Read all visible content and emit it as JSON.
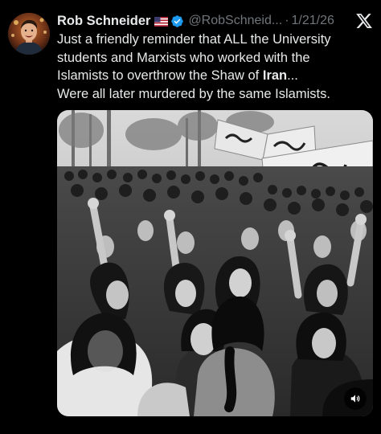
{
  "author": {
    "display_name": "Rob Schneider",
    "handle": "@RobSchneid...",
    "flag_icon": "us-flag-icon",
    "verified_icon": "verified-badge-icon",
    "verified_color": "#1d9bf0"
  },
  "meta": {
    "separator": "·",
    "date": "1/21/26",
    "platform_icon": "x-logo-icon"
  },
  "tweet": {
    "line1": "Just a friendly reminder that ALL the University",
    "line2": "students and Marxists who worked with the",
    "line3_pre": "Islamists to overthrow the Shaw of ",
    "line3_bold": "Iran",
    "line3_post": "...",
    "line4": "Were all later murdered by the same Islamists."
  },
  "media": {
    "kind": "black-and-white protest photograph",
    "volume_icon": "volume-icon"
  },
  "colors": {
    "background": "#000000",
    "text": "#e7e9ea",
    "secondary_text": "#71767b"
  }
}
